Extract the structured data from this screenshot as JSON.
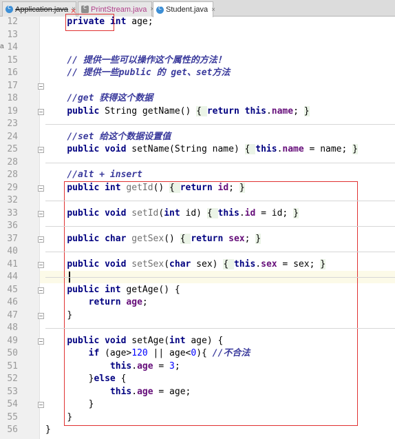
{
  "tabs": [
    {
      "label": "Application.java",
      "icon": "class-c-icon",
      "close": "×",
      "strike": true
    },
    {
      "label": "PrintStream.java",
      "icon": "library-class-icon",
      "close": "×",
      "pink": true
    },
    {
      "label": "Student.java",
      "icon": "class-c-icon",
      "close": "×",
      "active": true
    }
  ],
  "edge_mark": "a",
  "code": [
    {
      "n": "12",
      "parts": [
        [
          "kw",
          "private"
        ],
        [
          "t",
          " "
        ],
        [
          "kw",
          "int"
        ],
        [
          "t",
          " age;"
        ]
      ]
    },
    {
      "n": "13",
      "parts": []
    },
    {
      "n": "14",
      "parts": []
    },
    {
      "n": "15",
      "parts": [
        [
          "cmb",
          "// 提供一些可以操作这个属性的方法！"
        ]
      ]
    },
    {
      "n": "16",
      "parts": [
        [
          "cmb",
          "// 提供一些public 的 get、set方法"
        ]
      ]
    },
    {
      "n": "17",
      "parts": []
    },
    {
      "n": "18",
      "parts": [
        [
          "cmb",
          "//get 获得这个数据"
        ]
      ]
    },
    {
      "n": "19",
      "parts": [
        [
          "kw",
          "public"
        ],
        [
          "t",
          " String getName() "
        ],
        [
          "fr",
          "{ "
        ],
        [
          "kw",
          "return"
        ],
        [
          "t",
          " "
        ],
        [
          "kw",
          "this"
        ],
        [
          "t",
          "."
        ],
        [
          "fld",
          "name"
        ],
        [
          "t",
          "; "
        ],
        [
          "fr",
          "}"
        ]
      ]
    },
    {
      "n": "23",
      "parts": []
    },
    {
      "n": "24",
      "parts": [
        [
          "cmb",
          "//set 给这个数据设置值"
        ]
      ]
    },
    {
      "n": "25",
      "parts": [
        [
          "kw",
          "public"
        ],
        [
          "t",
          " "
        ],
        [
          "kw",
          "void"
        ],
        [
          "t",
          " setName(String name) "
        ],
        [
          "fr",
          "{ "
        ],
        [
          "kw",
          "this"
        ],
        [
          "t",
          "."
        ],
        [
          "fld",
          "name"
        ],
        [
          "t",
          " = name; "
        ],
        [
          "fr",
          "}"
        ]
      ]
    },
    {
      "n": "28",
      "parts": []
    },
    {
      "n": "28",
      "parts": [
        [
          "cmb",
          "//alt + insert"
        ]
      ]
    },
    {
      "n": "29",
      "parts": [
        [
          "kw",
          "public"
        ],
        [
          "t",
          " "
        ],
        [
          "kw",
          "int"
        ],
        [
          "t",
          " "
        ],
        [
          "un",
          "getId"
        ],
        [
          "t",
          "() "
        ],
        [
          "fr",
          "{ "
        ],
        [
          "kw",
          "return"
        ],
        [
          "t",
          " "
        ],
        [
          "fld",
          "id"
        ],
        [
          "t",
          "; "
        ],
        [
          "fr",
          "}"
        ]
      ]
    },
    {
      "n": "32",
      "parts": []
    },
    {
      "n": "33",
      "parts": [
        [
          "kw",
          "public"
        ],
        [
          "t",
          " "
        ],
        [
          "kw",
          "void"
        ],
        [
          "t",
          " "
        ],
        [
          "un",
          "setId"
        ],
        [
          "t",
          "("
        ],
        [
          "kw",
          "int"
        ],
        [
          "t",
          " id) "
        ],
        [
          "fr",
          "{ "
        ],
        [
          "kw",
          "this"
        ],
        [
          "t",
          "."
        ],
        [
          "fld",
          "id"
        ],
        [
          "t",
          " = id; "
        ],
        [
          "fr",
          "}"
        ]
      ]
    },
    {
      "n": "36",
      "parts": []
    },
    {
      "n": "37",
      "parts": [
        [
          "kw",
          "public"
        ],
        [
          "t",
          " "
        ],
        [
          "kw",
          "char"
        ],
        [
          "t",
          " "
        ],
        [
          "un",
          "getSex"
        ],
        [
          "t",
          "() "
        ],
        [
          "fr",
          "{ "
        ],
        [
          "kw",
          "return"
        ],
        [
          "t",
          " "
        ],
        [
          "fld",
          "sex"
        ],
        [
          "t",
          "; "
        ],
        [
          "fr",
          "}"
        ]
      ]
    },
    {
      "n": "40",
      "parts": []
    },
    {
      "n": "41",
      "parts": [
        [
          "kw",
          "public"
        ],
        [
          "t",
          " "
        ],
        [
          "kw",
          "void"
        ],
        [
          "t",
          " "
        ],
        [
          "un",
          "setSex"
        ],
        [
          "t",
          "("
        ],
        [
          "kw",
          "char"
        ],
        [
          "t",
          " sex) "
        ],
        [
          "fr",
          "{ "
        ],
        [
          "kw",
          "this"
        ],
        [
          "t",
          "."
        ],
        [
          "fld",
          "sex"
        ],
        [
          "t",
          " = sex; "
        ],
        [
          "fr",
          "}"
        ]
      ]
    },
    {
      "n": "44",
      "parts": []
    },
    {
      "n": "45",
      "parts": [
        [
          "kw",
          "public"
        ],
        [
          "t",
          " "
        ],
        [
          "kw",
          "int"
        ],
        [
          "t",
          " getAge() {"
        ]
      ]
    },
    {
      "n": "46",
      "parts": [
        [
          "t",
          "    "
        ],
        [
          "kw",
          "return"
        ],
        [
          "t",
          " "
        ],
        [
          "fld",
          "age"
        ],
        [
          "t",
          ";"
        ]
      ]
    },
    {
      "n": "47",
      "parts": [
        [
          "t",
          "}"
        ]
      ]
    },
    {
      "n": "48",
      "parts": []
    },
    {
      "n": "49",
      "parts": [
        [
          "kw",
          "public"
        ],
        [
          "t",
          " "
        ],
        [
          "kw",
          "void"
        ],
        [
          "t",
          " setAge("
        ],
        [
          "kw",
          "int"
        ],
        [
          "t",
          " age) {"
        ]
      ]
    },
    {
      "n": "50",
      "parts": [
        [
          "t",
          "    "
        ],
        [
          "kw",
          "if"
        ],
        [
          "t",
          " (age>"
        ],
        [
          "num",
          "120"
        ],
        [
          "t",
          " || age<"
        ],
        [
          "num",
          "0"
        ],
        [
          "t",
          "){ "
        ],
        [
          "cmb",
          "//不合法"
        ]
      ]
    },
    {
      "n": "51",
      "parts": [
        [
          "t",
          "        "
        ],
        [
          "kw",
          "this"
        ],
        [
          "t",
          "."
        ],
        [
          "fld",
          "age"
        ],
        [
          "t",
          " = "
        ],
        [
          "num",
          "3"
        ],
        [
          "t",
          ";"
        ]
      ]
    },
    {
      "n": "52",
      "parts": [
        [
          "t",
          "    }"
        ],
        [
          "kw",
          "else"
        ],
        [
          "t",
          " {"
        ]
      ]
    },
    {
      "n": "53",
      "parts": [
        [
          "t",
          "        "
        ],
        [
          "kw",
          "this"
        ],
        [
          "t",
          "."
        ],
        [
          "fld",
          "age"
        ],
        [
          "t",
          " = age;"
        ]
      ]
    },
    {
      "n": "54",
      "parts": [
        [
          "t",
          "    }"
        ]
      ]
    },
    {
      "n": "55",
      "parts": [
        [
          "t",
          "}"
        ]
      ]
    },
    {
      "n": "56",
      "parts": [
        [
          "t",
          "}"
        ]
      ]
    }
  ],
  "colors": {
    "keyword": "#000080",
    "field": "#660e7a",
    "comment": "#3a3a9c",
    "number": "#0000ff",
    "annotation_box": "#e03030"
  }
}
